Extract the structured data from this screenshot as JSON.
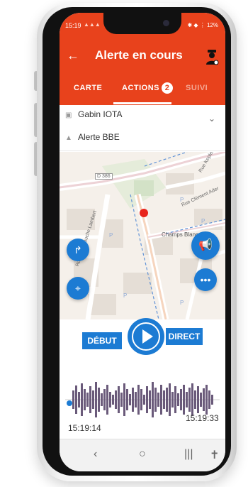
{
  "status_bar": {
    "time": "15:19",
    "warnings": "▲▲▲",
    "right": "✱ ◆ ⋮ 12%"
  },
  "app_bar": {
    "title": "Alerte en cours",
    "back_icon": "back-arrow-icon",
    "agent_icon": "police-officer-icon"
  },
  "tabs": [
    {
      "label": "CARTE"
    },
    {
      "label": "ACTIONS",
      "badge": "2",
      "selected": true
    },
    {
      "label": "SUIVI"
    }
  ],
  "info": {
    "person": "Gabin IOTA",
    "alert": "Alerte BBE"
  },
  "map": {
    "labels": {
      "d386": "D 386",
      "champs_blancs": "Champs Blancs",
      "rue_clement_ader": "Rue Clément Ader",
      "rue_touche_lambert": "Rue de la Touche Lambert",
      "rue_kepler": "Rue Kepler"
    }
  },
  "player": {
    "start_label": "DÉBUT",
    "live_label": "DIRECT",
    "time_start": "15:19:14",
    "time_end": "15:19:33",
    "progress": 0.0
  },
  "colors": {
    "brand": "#e8421c",
    "accent": "#1c7bd3",
    "marker": "#e8251c"
  }
}
